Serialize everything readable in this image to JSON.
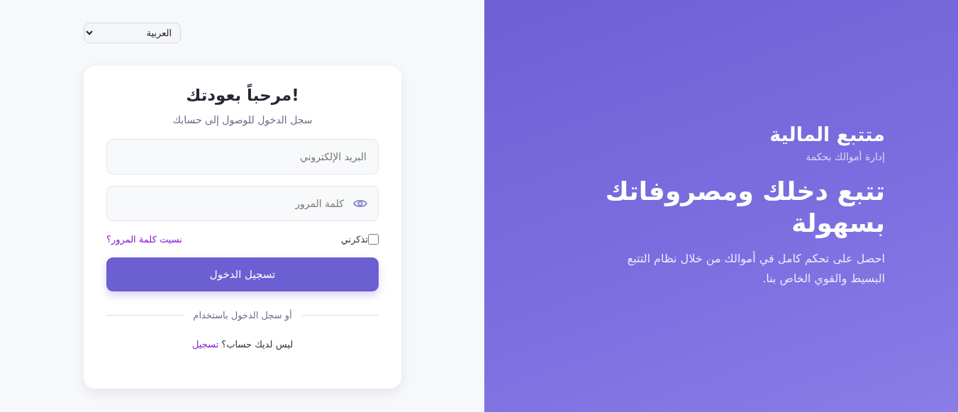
{
  "language_select": {
    "value": "العربية"
  },
  "login": {
    "title": "مرحباً بعودتك!",
    "subtitle": "سجل الدخول للوصول إلى حسابك",
    "email": {
      "placeholder": "البريد الإلكتروني"
    },
    "password": {
      "placeholder": "كلمة المرور"
    },
    "remember": {
      "label": "تذكرني",
      "checked": false
    },
    "forgot_link": "نسيت كلمة المرور؟",
    "submit": "تسجيل الدخول",
    "divider_text": "أو سجل الدخول باستخدام",
    "signup_prompt": "ليس لديك حساب؟",
    "signup_link": "تسجيل"
  },
  "hero": {
    "brand": "متتبع المالية",
    "tagline": "إدارة أموالك بحكمة",
    "headline": "تتبع دخلك ومصروفاتك بسهولة",
    "description": "احصل على تحكم كامل في أموالك من خلال نظام التتبع البسيط والقوي الخاص بنا."
  }
}
